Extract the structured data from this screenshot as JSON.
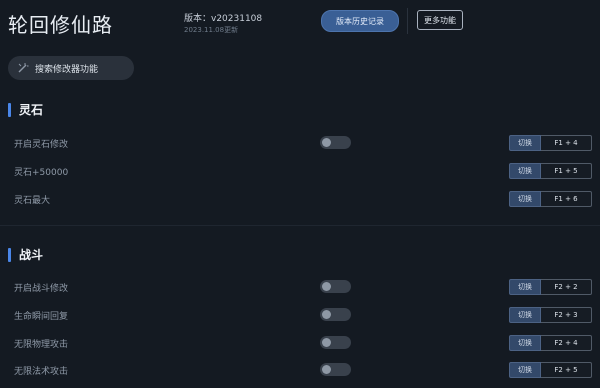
{
  "header": {
    "title": "轮回修仙路",
    "version": "版本：v20231108",
    "version_date": "2023.11.08更新",
    "history_button": "版本历史记录",
    "more_button": "更多功能"
  },
  "search": {
    "placeholder": "搜索修改器功能",
    "icon": "magic-wand-icon"
  },
  "switch_label": "切换",
  "sections": [
    {
      "title": "灵石",
      "rows": [
        {
          "label": "开启灵石修改",
          "hotkey": "F1 + 4",
          "enabled": false
        },
        {
          "label": "灵石+50000",
          "hotkey": "F1 + 5"
        },
        {
          "label": "灵石最大",
          "hotkey": "F1 + 6"
        }
      ]
    },
    {
      "title": "战斗",
      "rows": [
        {
          "label": "开启战斗修改",
          "hotkey": "F2 + 2",
          "enabled": false
        },
        {
          "label": "生命瞬间回复",
          "hotkey": "F2 + 3",
          "enabled": false
        },
        {
          "label": "无限物理攻击",
          "hotkey": "F2 + 4",
          "enabled": false
        },
        {
          "label": "无限法术攻击",
          "hotkey": "F2 + 5",
          "enabled": false
        }
      ]
    }
  ],
  "colors": {
    "accent": "#4a86e8",
    "background": "#141a22",
    "button": "#3a5f95"
  }
}
